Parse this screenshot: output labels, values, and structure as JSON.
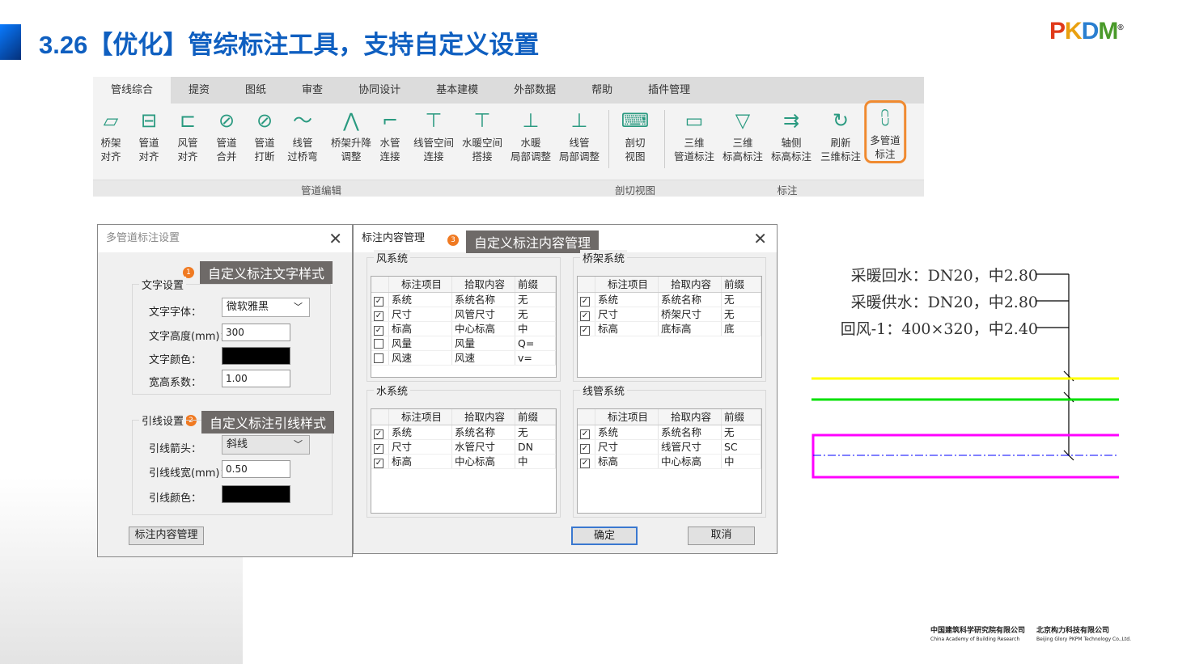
{
  "slide": {
    "title": "3.26【优化】管综标注工具，支持自定义设置",
    "logo": "PKPM",
    "logo_mark": "®",
    "accent": "#0f5fc0"
  },
  "ribbon": {
    "tabs": [
      "管线综合",
      "提资",
      "图纸",
      "审查",
      "协同设计",
      "基本建模",
      "外部数据",
      "帮助",
      "插件管理"
    ],
    "buttons": [
      {
        "l1": "桥架",
        "l2": "对齐",
        "icon": "tray-align-icon"
      },
      {
        "l1": "管道",
        "l2": "对齐",
        "icon": "pipe-align-icon"
      },
      {
        "l1": "风管",
        "l2": "对齐",
        "icon": "duct-align-icon"
      },
      {
        "l1": "管道",
        "l2": "合并",
        "icon": "pipe-merge-icon"
      },
      {
        "l1": "管道",
        "l2": "打断",
        "icon": "pipe-break-icon"
      },
      {
        "l1": "线管",
        "l2": "过桥弯",
        "icon": "conduit-bend-icon"
      },
      {
        "l1": "桥架升降",
        "l2": "调整",
        "icon": "tray-lift-icon"
      },
      {
        "l1": "水管",
        "l2": "连接",
        "icon": "water-connect-icon"
      },
      {
        "l1": "线管空间",
        "l2": "连接",
        "icon": "conduit-space-icon"
      },
      {
        "l1": "水暖空间",
        "l2": "搭接",
        "icon": "hvac-space-icon"
      },
      {
        "l1": "水暖",
        "l2": "局部调整",
        "icon": "hvac-local-icon"
      },
      {
        "l1": "线管",
        "l2": "局部调整",
        "icon": "conduit-local-icon"
      },
      {
        "l1": "剖切",
        "l2": "视图",
        "icon": "section-view-icon"
      },
      {
        "l1": "三维",
        "l2": "管道标注",
        "icon": "3d-pipe-label-icon"
      },
      {
        "l1": "三维",
        "l2": "标高标注",
        "icon": "3d-elevation-icon"
      },
      {
        "l1": "轴侧",
        "l2": "标高标注",
        "icon": "axon-elevation-icon"
      },
      {
        "l1": "刷新",
        "l2": "三维标注",
        "icon": "refresh-icon"
      },
      {
        "l1": "多管道",
        "l2": "标注",
        "icon": "multi-pipe-label-icon"
      }
    ],
    "groups": [
      "管道编辑",
      "剖切视图",
      "标注"
    ]
  },
  "settings_dialog": {
    "title": "多管道标注设置",
    "callout1": "自定义标注文字样式",
    "badge1": "1",
    "callout2": "自定义标注引线样式",
    "badge2": "2",
    "text_group": "文字设置",
    "font_label": "文字字体：",
    "font_value": "微软雅黑",
    "height_label": "文字高度(mm)：",
    "height_value": "300",
    "color_label": "文字颜色：",
    "ratio_label": "宽高系数：",
    "ratio_value": "1.00",
    "leader_group": "引线设置",
    "arrow_label": "引线箭头：",
    "arrow_value": "斜线",
    "width_label": "引线线宽(mm)：",
    "width_value": "0.50",
    "leader_color_label": "引线颜色：",
    "manage_button": "标注内容管理"
  },
  "content_dialog": {
    "title": "标注内容管理",
    "badge": "3",
    "callout": "自定义标注内容管理",
    "headers": [
      "标注项目",
      "拾取内容",
      "前缀"
    ],
    "groups": [
      {
        "name": "风系统",
        "rows": [
          {
            "c": true,
            "a": "系统",
            "b": "系统名称",
            "p": "无"
          },
          {
            "c": true,
            "a": "尺寸",
            "b": "风管尺寸",
            "p": "无"
          },
          {
            "c": true,
            "a": "标高",
            "b": "中心标高",
            "p": "中"
          },
          {
            "c": false,
            "a": "风量",
            "b": "风量",
            "p": "Q="
          },
          {
            "c": false,
            "a": "风速",
            "b": "风速",
            "p": "v="
          }
        ]
      },
      {
        "name": "桥架系统",
        "rows": [
          {
            "c": true,
            "a": "系统",
            "b": "系统名称",
            "p": "无"
          },
          {
            "c": true,
            "a": "尺寸",
            "b": "桥架尺寸",
            "p": "无"
          },
          {
            "c": true,
            "a": "标高",
            "b": "底标高",
            "p": "底"
          }
        ]
      },
      {
        "name": "水系统",
        "rows": [
          {
            "c": true,
            "a": "系统",
            "b": "系统名称",
            "p": "无"
          },
          {
            "c": true,
            "a": "尺寸",
            "b": "水管尺寸",
            "p": "DN"
          },
          {
            "c": true,
            "a": "标高",
            "b": "中心标高",
            "p": "中"
          }
        ]
      },
      {
        "name": "线管系统",
        "rows": [
          {
            "c": true,
            "a": "系统",
            "b": "系统名称",
            "p": "无"
          },
          {
            "c": true,
            "a": "尺寸",
            "b": "线管尺寸",
            "p": "SC"
          },
          {
            "c": true,
            "a": "标高",
            "b": "中心标高",
            "p": "中"
          }
        ]
      }
    ],
    "ok": "确定",
    "cancel": "取消"
  },
  "drawing": {
    "labels": [
      "采暖回水：DN20，中2.80",
      "采暖供水：DN20，中2.80",
      "回风-1：400×320，中2.40"
    ],
    "colors": {
      "line1": "#ffff00",
      "line2": "#00e000",
      "duct": "#ff00ff",
      "axis": "#0000ff"
    }
  },
  "footer": {
    "org1_cn": "中国建筑科学研究院有限公司",
    "org1_en": "China Academy of Building Research",
    "org2_cn": "北京构力科技有限公司",
    "org2_en": "Beijing Glory PKPM Technology Co.,Ltd."
  }
}
